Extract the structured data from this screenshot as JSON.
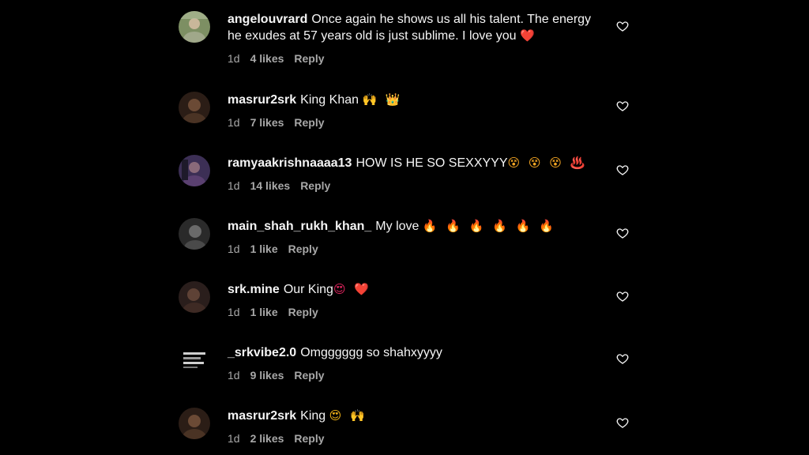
{
  "comments": [
    {
      "username": "angelouvrard",
      "text": "Once again he shows us all his talent. The energy he exudes at 57 years old is just sublime. I love you",
      "emoji": "❤️",
      "time": "1d",
      "likes": "4 likes",
      "reply": "Reply",
      "avatar_color": "#8a9a6a"
    },
    {
      "username": "masrur2srk",
      "text": "King Khan",
      "emoji": "🙌 👑",
      "time": "1d",
      "likes": "7 likes",
      "reply": "Reply",
      "avatar_color": "#3a2a20"
    },
    {
      "username": "ramyaakrishnaaaa13",
      "text": "HOW IS HE SO SEXXYYY",
      "emoji": "😵 😵 😵 ♨️",
      "time": "1d",
      "likes": "14 likes",
      "reply": "Reply",
      "avatar_color": "#4a3a60"
    },
    {
      "username": "main_shah_rukh_khan_",
      "text": "My love",
      "emoji": "🔥 🔥 🔥 🔥 🔥 🔥",
      "time": "1d",
      "likes": "1 like",
      "reply": "Reply",
      "avatar_color": "#404040"
    },
    {
      "username": "srk.mine",
      "text": "Our King",
      "emoji": "😍 ❤️",
      "time": "1d",
      "likes": "1 like",
      "reply": "Reply",
      "avatar_color": "#2e2220"
    },
    {
      "username": "_srkvibe2.0",
      "text": "Omgggggg so shahxyyyy",
      "emoji": "",
      "time": "1d",
      "likes": "9 likes",
      "reply": "Reply",
      "avatar_color": "#111111"
    },
    {
      "username": "masrur2srk",
      "text": "King",
      "emoji": "😍 🙌",
      "time": "1d",
      "likes": "2 likes",
      "reply": "Reply",
      "avatar_color": "#3a2a20"
    }
  ]
}
